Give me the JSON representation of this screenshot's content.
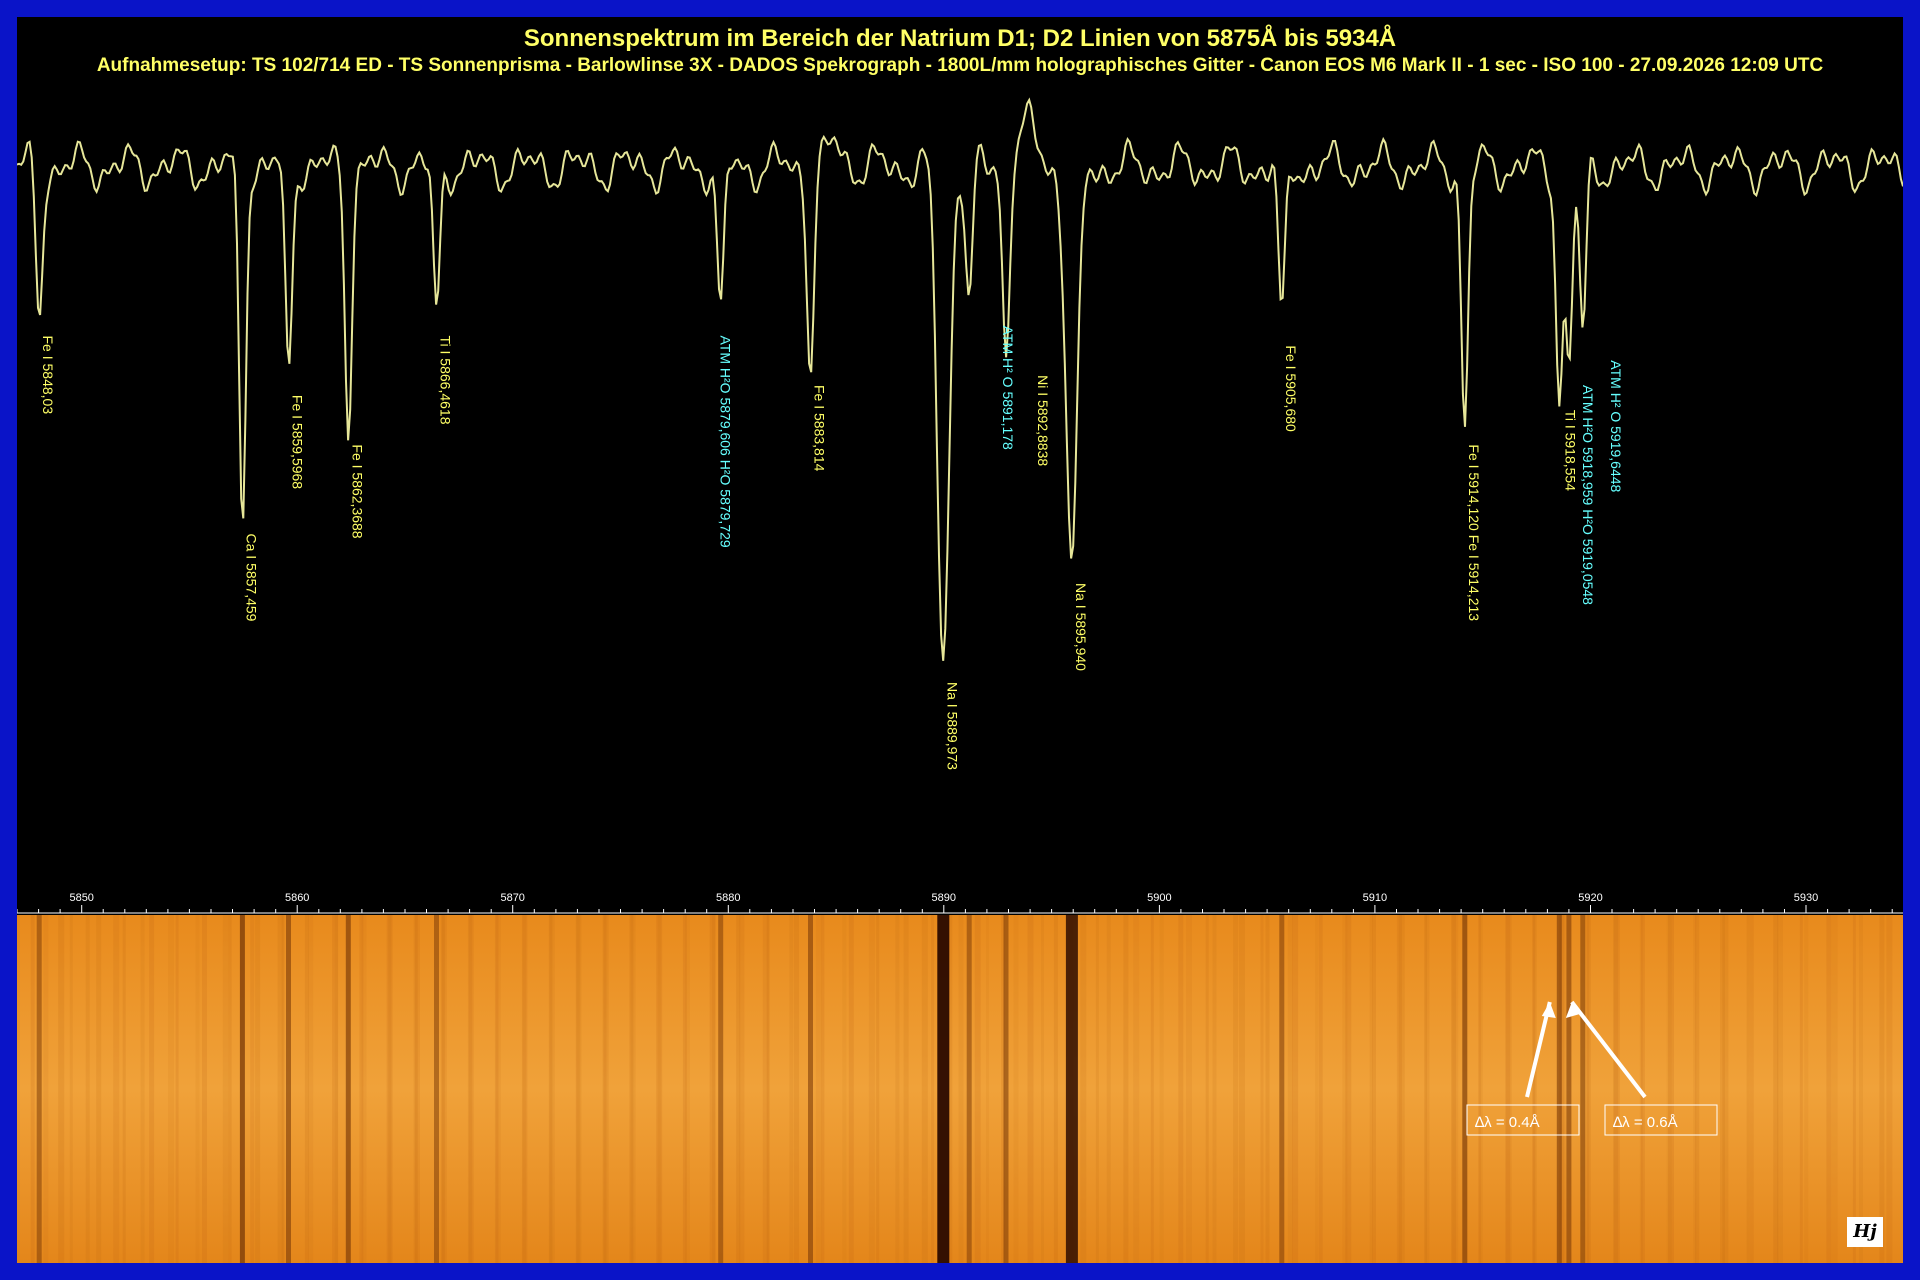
{
  "colors": {
    "border": "#0a14c8",
    "curve": "#e6e699",
    "yellow_label": "#ffff66",
    "cyan_label": "#66ffff",
    "tick": "#ffffff"
  },
  "header": {
    "title": "Sonnenspektrum im Bereich der Natrium  D1; D2 Linien von 5875Å bis 5934Å",
    "setup": "Aufnahmesetup: TS 102/714 ED - TS Sonnenprisma - Barlowlinse 3X - DADOS Spekrograph - 1800L/mm holographisches Gitter - Canon EOS M6 Mark II - 1 sec - ISO 100 - 27.09.2026 12:09 UTC"
  },
  "chart_data": {
    "type": "line",
    "x_range": [
      5847,
      5934.5
    ],
    "x_ticks": [
      "5850",
      "5860",
      "5870",
      "5880",
      "5890",
      "5900",
      "5910",
      "5920",
      "5930"
    ],
    "y_range": [
      0,
      1
    ],
    "grid": false,
    "lines": [
      {
        "label": "Fe I 5848,03",
        "wl": 5848.03,
        "depth": 0.3,
        "color": "yellow"
      },
      {
        "label": "Ca I 5857,459",
        "wl": 5857.459,
        "depth": 0.7,
        "color": "yellow"
      },
      {
        "label": "Fe I 5859,5968",
        "wl": 5859.5968,
        "depth": 0.42,
        "color": "yellow"
      },
      {
        "label": "Fe I 5862,3688",
        "wl": 5862.3688,
        "depth": 0.52,
        "color": "yellow"
      },
      {
        "label": "Ti I 5866,4618",
        "wl": 5866.4618,
        "depth": 0.3,
        "color": "yellow"
      },
      {
        "label": "ATM H²O 5879,606  H²O 5879,729",
        "wl": 5879.65,
        "depth": 0.3,
        "color": "cyan"
      },
      {
        "label": "Fe I 5883,814",
        "wl": 5883.814,
        "depth": 0.4,
        "color": "yellow"
      },
      {
        "label": "Na I 5889,973",
        "wl": 5889.973,
        "depth": 1.0,
        "color": "yellow"
      },
      {
        "label": "ATM  H² O  5891,178",
        "wl": 5891.178,
        "depth": 0.28,
        "color": "cyan"
      },
      {
        "label": "Ni I 5892,8838",
        "wl": 5892.8838,
        "depth": 0.38,
        "color": "yellow"
      },
      {
        "label": "Na I 5895,940",
        "wl": 5895.94,
        "depth": 0.8,
        "color": "yellow"
      },
      {
        "label": "Fe I 5905,680",
        "wl": 5905.68,
        "depth": 0.32,
        "color": "yellow"
      },
      {
        "label": "Fe I 5914,120  Fe I 5914,213",
        "wl": 5914.17,
        "depth": 0.52,
        "color": "yellow"
      },
      {
        "label": "Ti I 5918,554",
        "wl": 5918.554,
        "depth": 0.45,
        "color": "yellow"
      },
      {
        "label": "ATM H²O 5918,959  H²O  5919,0548",
        "wl": 5919.0,
        "depth": 0.4,
        "color": "cyan"
      },
      {
        "label": "ATM  H² O 5919,6448",
        "wl": 5919.6448,
        "depth": 0.35,
        "color": "cyan"
      }
    ],
    "annotations": [
      "∆λ = 0.4Å",
      "∆λ = 0.6Å"
    ]
  },
  "signature": "Hj"
}
